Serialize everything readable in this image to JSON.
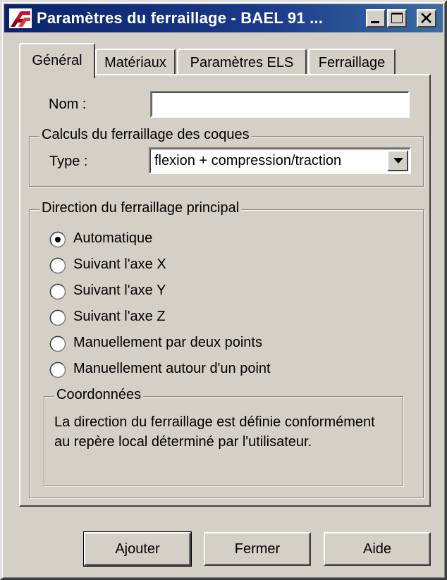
{
  "window": {
    "title": "Paramètres du ferraillage - BAEL 91 ..."
  },
  "tabs": [
    {
      "label": "Général",
      "active": true
    },
    {
      "label": "Matériaux",
      "active": false
    },
    {
      "label": "Paramètres ELS",
      "active": false
    },
    {
      "label": "Ferraillage",
      "active": false
    }
  ],
  "general": {
    "name_label": "Nom :",
    "name_value": "",
    "shell_group": {
      "title": "Calculs du ferraillage des coques",
      "type_label": "Type :",
      "type_value": "flexion + compression/traction"
    },
    "direction_group": {
      "title": "Direction du ferraillage principal",
      "options": [
        {
          "label": "Automatique",
          "selected": true
        },
        {
          "label": "Suivant l'axe X",
          "selected": false
        },
        {
          "label": "Suivant l'axe Y",
          "selected": false
        },
        {
          "label": "Suivant l'axe Z",
          "selected": false
        },
        {
          "label": "Manuellement par deux points",
          "selected": false
        },
        {
          "label": "Manuellement autour d'un point",
          "selected": false
        }
      ],
      "coords_group": {
        "title": "Coordonnées",
        "text": "La direction du ferraillage est définie conformément au repère local déterminé par l'utilisateur."
      }
    }
  },
  "buttons": {
    "add": "Ajouter",
    "close": "Fermer",
    "help": "Aide"
  },
  "colors": {
    "titlebar": "#0a246a",
    "face": "#d4d0c8",
    "icon_red": "#c8102e"
  }
}
